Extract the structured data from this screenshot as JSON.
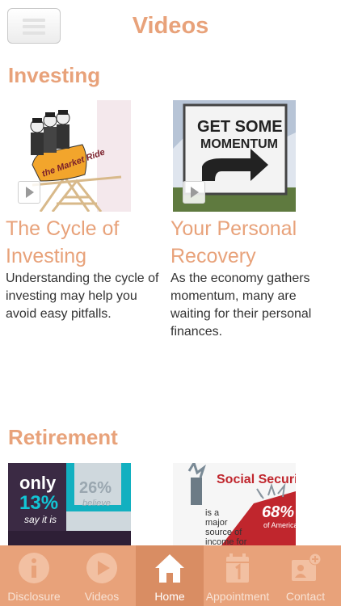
{
  "header": {
    "title": "Videos"
  },
  "sections": [
    {
      "title": "Investing",
      "items": [
        {
          "title": "The Cycle of Investing",
          "description": "Understanding the cycle of investing may help you avoid easy pitfalls.",
          "thumb_text": "the Market Ride"
        },
        {
          "title": "Your Personal Recovery",
          "description": "As the economy gathers momentum, many are waiting for their personal finances.",
          "thumb_text_1": "GET SOME",
          "thumb_text_2": "MOMENTUM"
        }
      ]
    },
    {
      "title": "Retirement",
      "items": [
        {
          "thumb_only": "only",
          "thumb_pct": "13%",
          "thumb_say": "say it is",
          "thumb_pct2": "26%",
          "thumb_believe": "believe"
        },
        {
          "thumb_title": "Social Securit",
          "thumb_lines": [
            "is a",
            "major",
            "source of",
            "income for"
          ],
          "thumb_pct": "68%",
          "thumb_pct_label": "of Americans"
        }
      ]
    }
  ],
  "tabbar": {
    "tabs": [
      {
        "label": "Disclosure",
        "icon": "info-icon"
      },
      {
        "label": "Videos",
        "icon": "play-icon"
      },
      {
        "label": "Home",
        "icon": "home-icon",
        "active": true
      },
      {
        "label": "Appointment",
        "icon": "calendar-icon"
      },
      {
        "label": "Contact",
        "icon": "contact-icon"
      }
    ]
  },
  "colors": {
    "accent": "#e8a27a",
    "tabbar": "#e8a27a",
    "text": "#333333"
  }
}
